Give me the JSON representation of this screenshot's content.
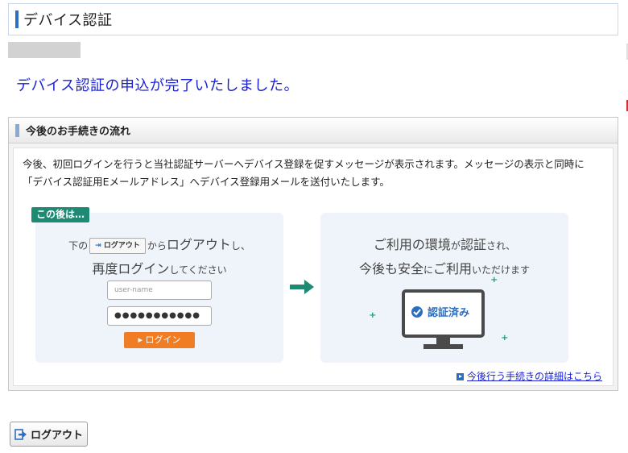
{
  "header": {
    "title": "デバイス認証"
  },
  "message": "デバイス認証の申込が完了いたしました。",
  "panel": {
    "title": "今後のお手続きの流れ",
    "description": "今後、初回ログインを行うと当社認証サーバーへデバイス登録を促すメッセージが表示されます。メッセージの表示と同時に「デバイス認証用Eメールアドレス」へデバイス登録用メールを送付いたします。",
    "badge": "この後は…",
    "step1": {
      "pre": "下の",
      "mini_button": "ログアウト",
      "mid": "から",
      "big": "ログアウト",
      "suffix": "し、",
      "line2_big": "再度ログイン",
      "line2_small": "してください",
      "username_placeholder": "user-name",
      "password_mask": "●●●●●●●●●●●",
      "login_label": "▸ ログイン"
    },
    "step2": {
      "l1_a": "ご利用の環境",
      "l1_b": "が",
      "l1_c": "認証",
      "l1_d": "され、",
      "l2_a": "今後も安全",
      "l2_b": "に",
      "l2_c": "ご利用",
      "l2_d": "いただけます",
      "monitor_label": "認証済み"
    },
    "details_link": "今後行う手続きの詳細はこちら"
  },
  "logout_button": {
    "label": "ログアウト"
  },
  "colors": {
    "accent": "#1a22d6",
    "brand_green": "#1e8a74",
    "login_orange": "#f07d24"
  }
}
